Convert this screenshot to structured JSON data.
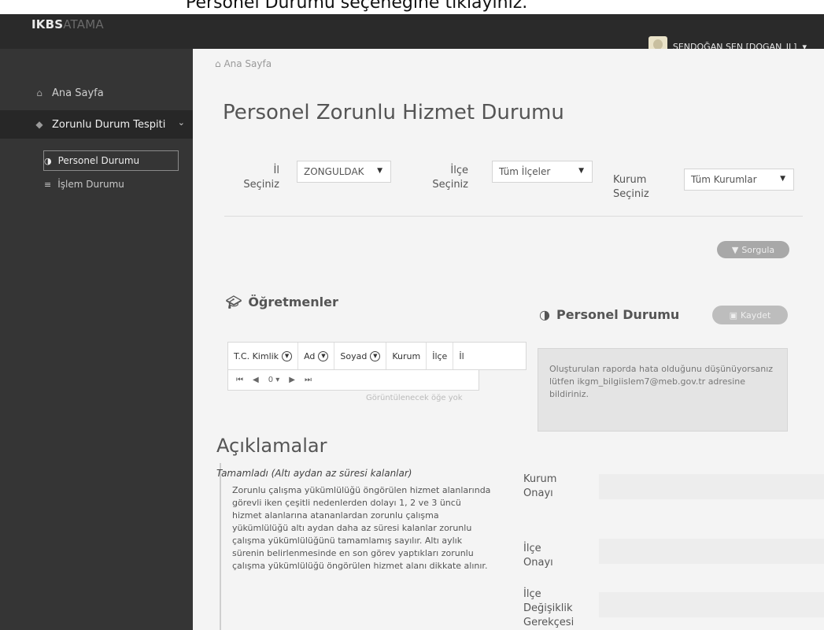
{
  "caption": "Personel Durumu seçeneğine tıklayınız.",
  "header": {
    "brand_bold": "IKBS",
    "brand_light": "ATAMA",
    "user": "ŞENDOĞAN ŞEN [DOGAN_IL]"
  },
  "sidebar": {
    "items": [
      {
        "label": "Ana Sayfa"
      },
      {
        "label": "Zorunlu Durum Tespiti"
      }
    ],
    "sub_items": [
      {
        "label": "Personel Durumu"
      },
      {
        "label": "İşlem Durumu"
      }
    ]
  },
  "main": {
    "breadcrumb": "Ana Sayfa",
    "title": "Personel Zorunlu Hizmet Durumu",
    "filters": {
      "il_label_1": "İl",
      "il_label_2": "Seçiniz",
      "il_value": "ZONGULDAK",
      "ilce_label_1": "İlçe",
      "ilce_label_2": "Seçiniz",
      "ilce_value": "Tüm İlçeler",
      "kurum_label_1": "Kurum",
      "kurum_label_2": "Seçiniz",
      "kurum_value": "Tüm Kurumlar"
    },
    "sorgula": "Sorgula",
    "teachers": {
      "title": "Öğretmenler",
      "columns": [
        "T.C. Kimlik",
        "Ad",
        "Soyad",
        "Kurum",
        "İlçe",
        "İl"
      ],
      "page_value": "0",
      "empty": "Görüntülenecek öğe yok"
    },
    "status": {
      "title": "Personel Durumu",
      "save": "Kaydet",
      "info": "Oluşturulan raporda hata olduğunu düşünüyorsanız lütfen ikgm_bilgiislem7@meb.gov.tr adresine bildiriniz."
    },
    "descriptions": {
      "title": "Açıklamalar",
      "subtitle": "Tamamladı (Altı aydan az süresi kalanlar)",
      "body": "Zorunlu çalışma yükümlülüğü öngörülen hizmet alanlarında görevli iken çeşitli nedenlerden dolayı 1, 2 ve 3 üncü hizmet alanlarına atananlardan zorunlu çalışma yükümlülüğü altı aydan daha az süresi kalanlar zorunlu çalışma yükümlülüğünü tamamlamış sayılır. Altı aylık sürenin belirlenmesinde en son görev yaptıkları zorunlu çalışma yükümlülüğü öngörülen hizmet alanı dikkate alınır."
    },
    "right_labels": {
      "kurum_onayi_1": "Kurum",
      "kurum_onayi_2": "Onayı",
      "ilce_onayi_1": "İlçe",
      "ilce_onayi_2": "Onayı",
      "ilce_degisiklik_1": "İlçe",
      "ilce_degisiklik_2": "Değişiklik",
      "ilce_degisiklik_3": "Gerekçesi"
    }
  }
}
